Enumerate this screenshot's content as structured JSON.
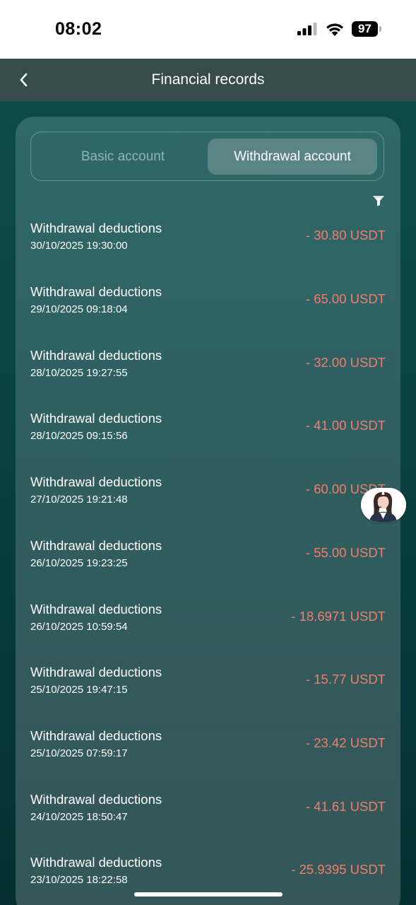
{
  "status_bar": {
    "time": "08:02",
    "battery": "97"
  },
  "header": {
    "title": "Financial records"
  },
  "tabs": [
    {
      "label": "Basic account",
      "active": false
    },
    {
      "label": "Withdrawal account",
      "active": true
    }
  ],
  "records": [
    {
      "title": "Withdrawal deductions",
      "time": "30/10/2025 19:30:00",
      "amount": "- 30.80 USDT"
    },
    {
      "title": "Withdrawal deductions",
      "time": "29/10/2025 09:18:04",
      "amount": "- 65.00 USDT"
    },
    {
      "title": "Withdrawal deductions",
      "time": "28/10/2025 19:27:55",
      "amount": "- 32.00 USDT"
    },
    {
      "title": "Withdrawal deductions",
      "time": "28/10/2025 09:15:56",
      "amount": "- 41.00 USDT"
    },
    {
      "title": "Withdrawal deductions",
      "time": "27/10/2025 19:21:48",
      "amount": "- 60.00 USDT"
    },
    {
      "title": "Withdrawal deductions",
      "time": "26/10/2025 19:23:25",
      "amount": "- 55.00 USDT"
    },
    {
      "title": "Withdrawal deductions",
      "time": "26/10/2025 10:59:54",
      "amount": "- 18.6971 USDT"
    },
    {
      "title": "Withdrawal deductions",
      "time": "25/10/2025 19:47:15",
      "amount": "- 15.77 USDT"
    },
    {
      "title": "Withdrawal deductions",
      "time": "25/10/2025 07:59:17",
      "amount": "- 23.42 USDT"
    },
    {
      "title": "Withdrawal deductions",
      "time": "24/10/2025 18:50:47",
      "amount": "- 41.61 USDT"
    },
    {
      "title": "Withdrawal deductions",
      "time": "23/10/2025 18:22:58",
      "amount": "- 25.9395 USDT"
    }
  ],
  "icons": {
    "back": "chevron-left-icon",
    "filter": "filter-icon",
    "support": "customer-service-avatar",
    "signal": "cellular-signal-icon",
    "wifi": "wifi-icon",
    "battery": "battery-icon"
  },
  "colors": {
    "background": "#0a4443",
    "header_bar": "#364b4b",
    "card": "#2f6464",
    "active_tab": "#5b8584",
    "inactive_tab_text": "#8fb3b2",
    "amount_negative": "#f07e6e"
  }
}
